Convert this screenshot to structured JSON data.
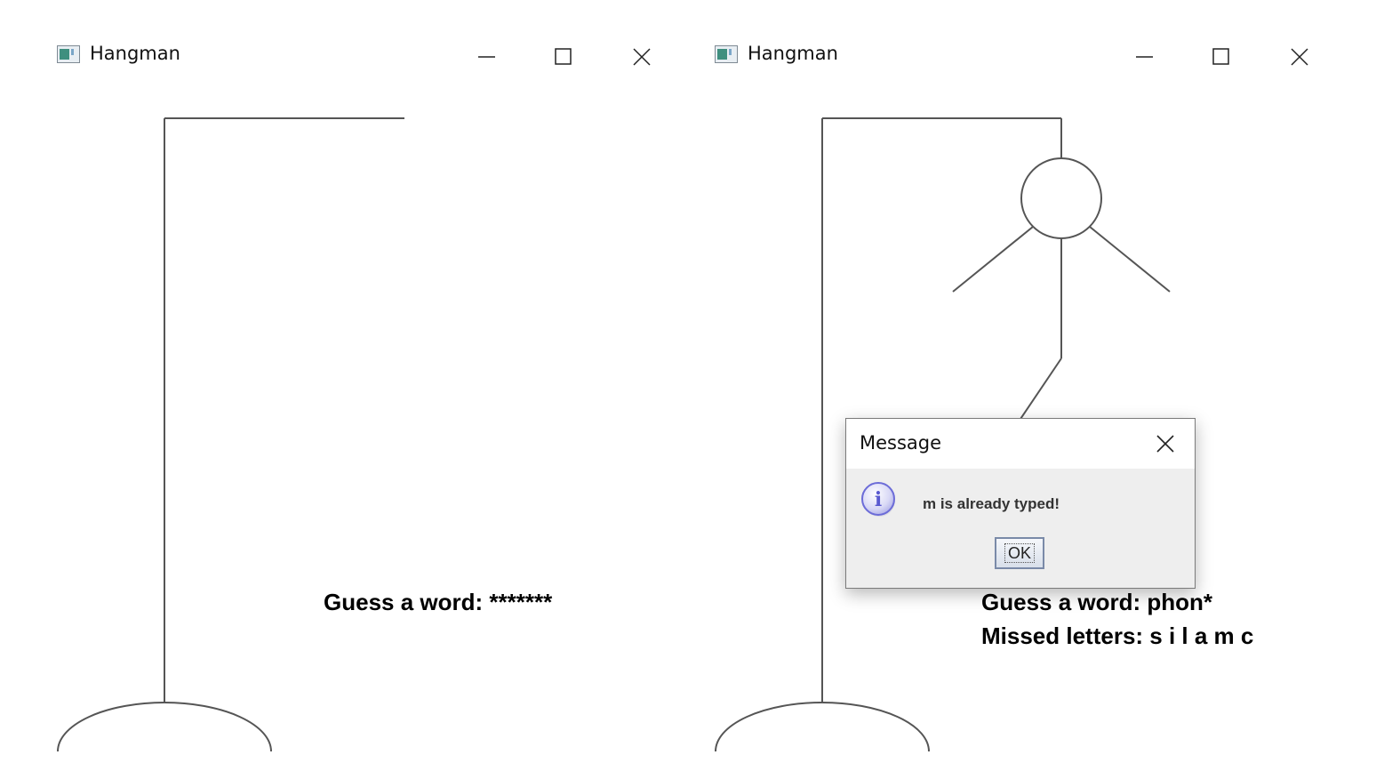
{
  "windows": [
    {
      "title": "Hangman",
      "guess_text": "Guess a word: *******",
      "missed_text": "",
      "misses": 0
    },
    {
      "title": "Hangman",
      "guess_text": "Guess a word: phon*",
      "missed_text": "Missed letters: s i l a m c",
      "misses": 6
    }
  ],
  "dialog": {
    "title": "Message",
    "message": "m is already typed!",
    "ok_label": "OK",
    "icon": "info-icon"
  },
  "icons": {
    "app": "app-window-icon",
    "minimize": "minimize-icon",
    "maximize": "maximize-icon",
    "close": "close-icon"
  },
  "colors": {
    "line": "#555555",
    "info_icon": "#6c6cd8"
  }
}
